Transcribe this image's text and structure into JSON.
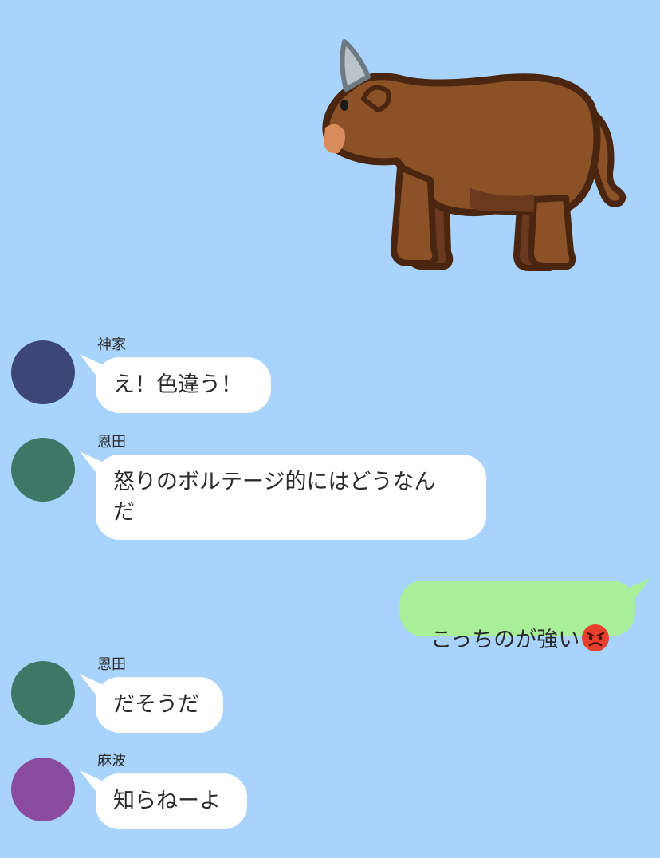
{
  "sticker": {
    "icon": "cow-sticker"
  },
  "messages": [
    {
      "sender": "神家",
      "text": "え！色違う！",
      "avatar_color": "#3d4777"
    },
    {
      "sender": "恩田",
      "text": "怒りのボルテージ的にはどうなん\nだ",
      "avatar_color": "#3f7766"
    },
    {
      "outgoing_text": "こっちのが強い",
      "emoji": "angry-face-icon"
    },
    {
      "sender": "恩田",
      "text": "だそうだ",
      "avatar_color": "#3f7766"
    },
    {
      "sender": "麻波",
      "text": "知らねーよ",
      "avatar_color": "#8b4c9f"
    }
  ],
  "colors": {
    "background": "#a8d3fc",
    "incoming_bubble": "#ffffff",
    "outgoing_bubble": "#a9ef9a"
  }
}
